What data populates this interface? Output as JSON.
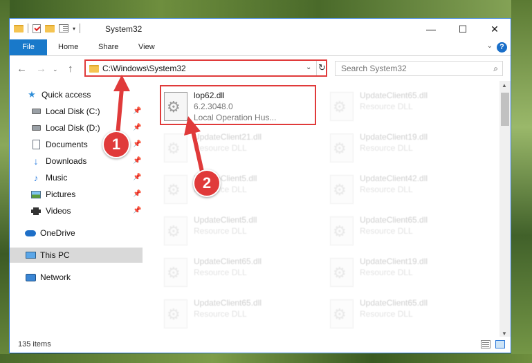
{
  "window": {
    "title": "System32",
    "buttons": {
      "minimize": "—",
      "maximize": "☐",
      "close": "✕"
    }
  },
  "ribbon": {
    "tabs": [
      "File",
      "Home",
      "Share",
      "View"
    ],
    "help": "?"
  },
  "address": {
    "path": "C:\\Windows\\System32",
    "search_placeholder": "Search System32"
  },
  "sidebar": {
    "items": [
      {
        "label": "Quick access",
        "icon": "star-icon",
        "pinned": false
      },
      {
        "label": "Local Disk (C:)",
        "icon": "disk-icon",
        "pinned": true
      },
      {
        "label": "Local Disk (D:)",
        "icon": "disk-icon",
        "pinned": true
      },
      {
        "label": "Documents",
        "icon": "document-icon",
        "pinned": true
      },
      {
        "label": "Downloads",
        "icon": "download-icon",
        "pinned": true
      },
      {
        "label": "Music",
        "icon": "music-icon",
        "pinned": true
      },
      {
        "label": "Pictures",
        "icon": "pictures-icon",
        "pinned": true
      },
      {
        "label": "Videos",
        "icon": "videos-icon",
        "pinned": true
      },
      {
        "label": "OneDrive",
        "icon": "onedrive-icon",
        "pinned": false
      },
      {
        "label": "This PC",
        "icon": "this-pc-icon",
        "pinned": false
      },
      {
        "label": "Network",
        "icon": "network-icon",
        "pinned": false
      }
    ]
  },
  "files": {
    "highlighted": {
      "name": "lop62.dll",
      "version": "6.2.3048.0",
      "description": "Local Operation Hus..."
    },
    "faded": [
      {
        "name": "UpdateClient65.dll",
        "type": "Resource DLL"
      },
      {
        "name": "UpdateClient21.dll",
        "type": "Resource DLL"
      },
      {
        "name": "UpdateClient19.dll",
        "type": "Resource DLL"
      },
      {
        "name": "UpdateClient5.dll",
        "type": "Resource DLL"
      },
      {
        "name": "UpdateClient42.dll",
        "type": "Resource DLL"
      },
      {
        "name": "UpdateClient5.dll",
        "type": "Resource DLL"
      },
      {
        "name": "UpdateClient65.dll",
        "type": "Resource DLL"
      },
      {
        "name": "UpdateClient65.dll",
        "type": "Resource DLL"
      },
      {
        "name": "UpdateClient19.dll",
        "type": "Resource DLL"
      },
      {
        "name": "UpdateClient65.dll",
        "type": "Resource DLL"
      },
      {
        "name": "UpdateClient65.dll",
        "type": "Resource DLL"
      }
    ]
  },
  "status": {
    "item_count": "135 items"
  },
  "annotations": {
    "step1": "1",
    "step2": "2",
    "color": "#e03a3a"
  }
}
